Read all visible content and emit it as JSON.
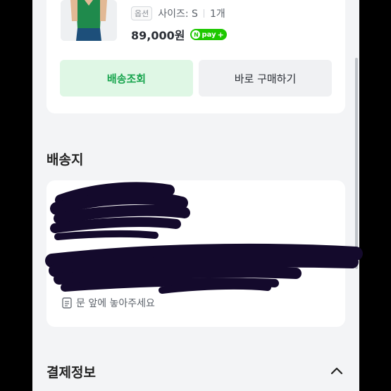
{
  "order": {
    "option_badge": "옵션",
    "option_text": "사이즈: S",
    "quantity": "1개",
    "price": "89,000원",
    "npay_label": "pay",
    "npay_n": "N",
    "npay_plus": "+",
    "tracking_button": "배송조회",
    "rebuy_button": "바로 구매하기"
  },
  "shipping": {
    "title": "배송지",
    "delivery_memo": "문 앞에 놓아주세요"
  },
  "payment": {
    "title": "결제정보"
  },
  "colors": {
    "accent_green": "#17a44d",
    "accent_green_bg": "#dff7e5",
    "npay_green": "#1ec800",
    "redaction": "#140a2c"
  },
  "icons": {
    "memo": "memo-icon",
    "collapse": "chevron-up-icon"
  }
}
